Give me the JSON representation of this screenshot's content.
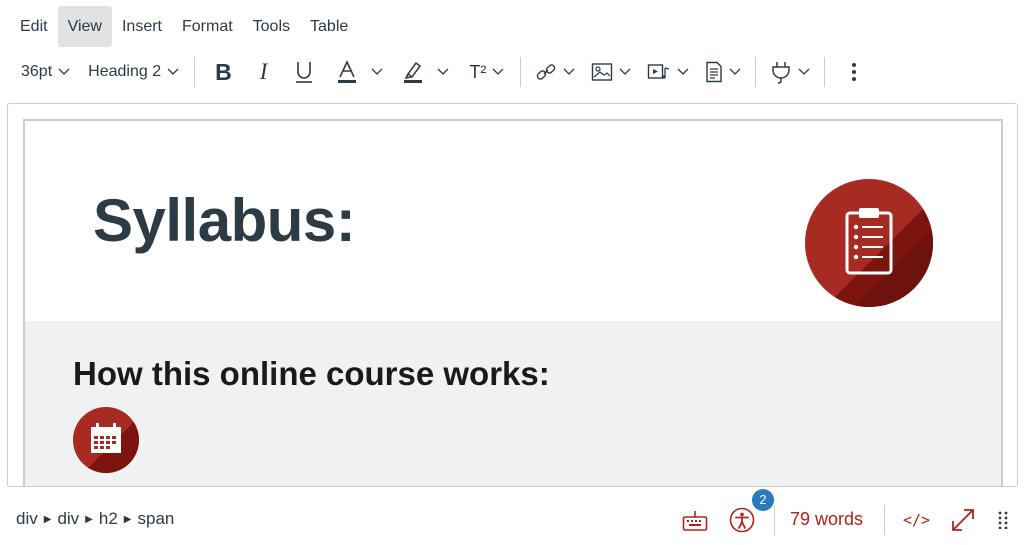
{
  "menubar": {
    "items": [
      {
        "label": "Edit"
      },
      {
        "label": "View"
      },
      {
        "label": "Insert"
      },
      {
        "label": "Format"
      },
      {
        "label": "Tools"
      },
      {
        "label": "Table"
      }
    ],
    "active": "View"
  },
  "toolbar": {
    "font_size": "36pt",
    "block_format": "Heading 2",
    "bold_label": "B",
    "italic_label": "I",
    "superscript_label": "T²"
  },
  "content": {
    "title": "Syllabus:",
    "section_heading": "How this online course works:"
  },
  "statusbar": {
    "path": [
      "div",
      "div",
      "h2",
      "span"
    ],
    "accessibility_issue_count": "2",
    "word_count": "79 words",
    "html_toggle": "</>"
  },
  "colors": {
    "accent": "#b2221b",
    "icon_red": "#a72b22",
    "icon_red_dark": "#7c1510",
    "badge_blue": "#2b7abc",
    "gray_bg": "#f0f1f2",
    "menu_active_bg": "#e0e2e4"
  },
  "icons": [
    "chevron-down-icon",
    "bold-icon",
    "italic-icon",
    "underline-icon",
    "text-color-icon",
    "highlight-icon",
    "superscript-icon",
    "link-icon",
    "image-icon",
    "media-icon",
    "document-icon",
    "plugin-icon",
    "more-icon",
    "clipboard-icon",
    "calendar-icon",
    "keyboard-icon",
    "accessibility-icon",
    "fullscreen-icon",
    "drag-handle-icon"
  ]
}
